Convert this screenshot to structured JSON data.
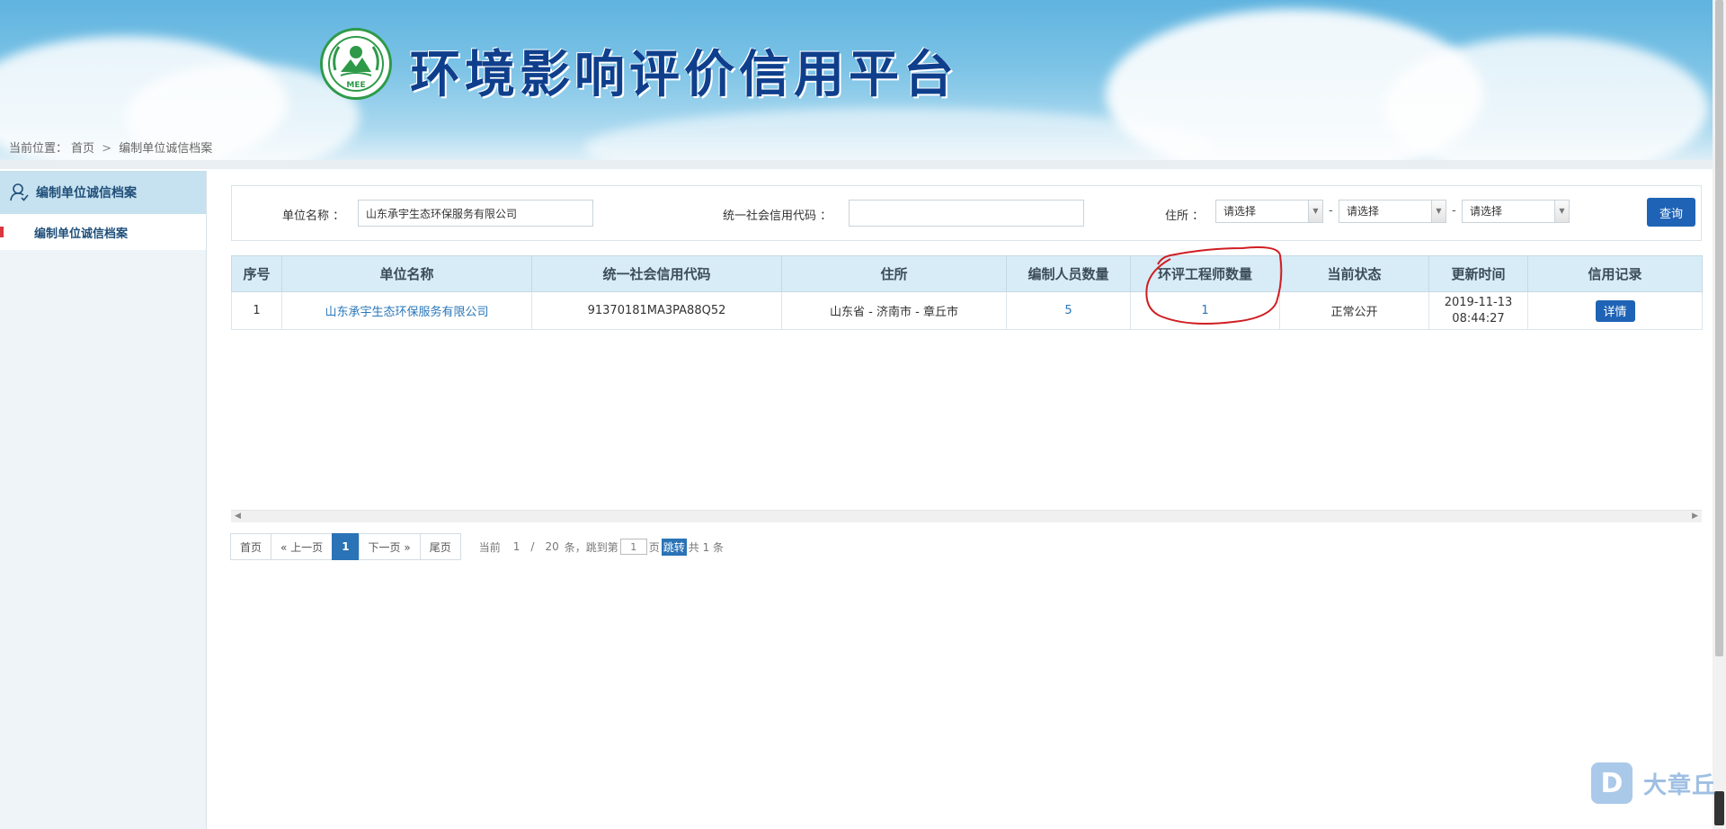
{
  "header": {
    "logo_text": "MEE",
    "site_title": "环境影响评价信用平台"
  },
  "breadcrumb": {
    "prefix": "当前位置：",
    "home": "首页",
    "separator": ">",
    "current": "编制单位诚信档案"
  },
  "sidebar": {
    "heading": "编制单位诚信档案",
    "items": [
      {
        "label": "编制单位诚信档案"
      }
    ]
  },
  "search": {
    "unit_name_label": "单位名称 ：",
    "unit_name_value": "山东承宇生态环保服务有限公司",
    "credit_code_label": "统一社会信用代码 ：",
    "credit_code_value": "",
    "address_label": "住所 ：",
    "province_select": "请选择",
    "city_select": "请选择",
    "district_select": "请选择",
    "dash": "-",
    "query_button": "查询"
  },
  "table": {
    "columns": [
      "序号",
      "单位名称",
      "统一社会信用代码",
      "住所",
      "编制人员数量",
      "环评工程师数量",
      "当前状态",
      "更新时间",
      "信用记录"
    ],
    "rows": [
      {
        "index": "1",
        "unit_name": "山东承宇生态环保服务有限公司",
        "credit_code": "91370181MA3PA88Q52",
        "address": "山东省 - 济南市 - 章丘市",
        "staff_count": "5",
        "engineer_count": "1",
        "status": "正常公开",
        "update_date": "2019-11-13",
        "update_time": "08:44:27",
        "record_button": "详情"
      }
    ]
  },
  "pagination": {
    "first": "首页",
    "prev": "« 上一页",
    "current_page": "1",
    "next": "下一页 »",
    "last": "尾页",
    "current_label": "当前",
    "page_value": "1",
    "slash": "/",
    "page_size": "20",
    "jump_text": "条，跳到第",
    "jump_input": "1",
    "page_unit": "页",
    "jump_button": "跳转",
    "total_text": "共 1 条"
  },
  "watermark": {
    "badge": "D",
    "text": "大章丘"
  },
  "colors": {
    "title": "#0f3f8c",
    "accent_button": "#1f63b6",
    "table_header_bg": "#d7ecf6",
    "annotation_circle": "#d01e22"
  }
}
